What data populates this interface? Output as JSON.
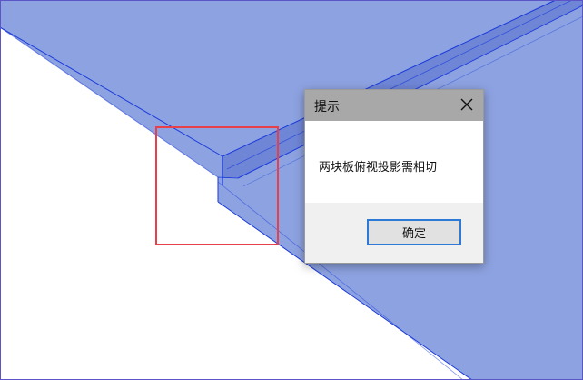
{
  "scene": {
    "plate_color": "#8da2e1",
    "edge_color": "#1a3adb",
    "selection_color": "#e8404a",
    "frame_color": "#5b55c8"
  },
  "dialog": {
    "title": "提示",
    "message": "两块板俯视投影需相切",
    "ok_label": "确定",
    "close_icon": "close-icon",
    "titlebar_color": "#a8a8a8",
    "footer_color": "#f0f0f0",
    "button_border_color": "#2d7ad6"
  }
}
